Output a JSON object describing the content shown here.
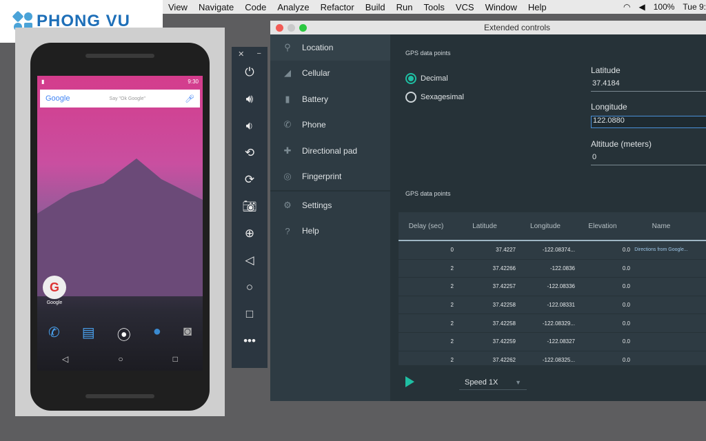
{
  "menubar": {
    "items": [
      "View",
      "Navigate",
      "Code",
      "Analyze",
      "Refactor",
      "Build",
      "Run",
      "Tools",
      "VCS",
      "Window",
      "Help"
    ],
    "battery": "100%",
    "clock": "Tue 9:"
  },
  "logo": {
    "text": "PHONG VU"
  },
  "phone": {
    "time": "9:30",
    "search_brand": "Google",
    "search_hint": "Say \"Ok Google\"",
    "app_label": "Google"
  },
  "window": {
    "title": "Extended controls"
  },
  "sidebar": {
    "items": [
      {
        "label": "Location",
        "icon": "location-pin"
      },
      {
        "label": "Cellular",
        "icon": "signal"
      },
      {
        "label": "Battery",
        "icon": "battery"
      },
      {
        "label": "Phone",
        "icon": "phone"
      },
      {
        "label": "Directional pad",
        "icon": "dpad"
      },
      {
        "label": "Fingerprint",
        "icon": "fingerprint"
      },
      {
        "label": "Settings",
        "icon": "gear"
      },
      {
        "label": "Help",
        "icon": "help"
      }
    ]
  },
  "main": {
    "section1": "GPS data points",
    "decimal": "Decimal",
    "sexagesimal": "Sexagesimal",
    "latitude_label": "Latitude",
    "latitude": "37.4184",
    "longitude_label": "Longitude",
    "longitude": "122.0880",
    "altitude_label": "Altitude (meters)",
    "altitude": "0",
    "section2": "GPS data points",
    "speed": "Speed 1X"
  },
  "table": {
    "headers": [
      "Delay (sec)",
      "Latitude",
      "Longitude",
      "Elevation",
      "Name"
    ],
    "rows": [
      [
        "0",
        "37.4227",
        "-122.08374...",
        "0.0",
        "Directions from Google..."
      ],
      [
        "2",
        "37.42266",
        "-122.0836",
        "0.0",
        ""
      ],
      [
        "2",
        "37.42257",
        "-122.08336",
        "0.0",
        ""
      ],
      [
        "2",
        "37.42258",
        "-122.08331",
        "0.0",
        ""
      ],
      [
        "2",
        "37.42258",
        "-122.08329...",
        "0.0",
        ""
      ],
      [
        "2",
        "37.42259",
        "-122.08327",
        "0.0",
        ""
      ],
      [
        "2",
        "37.42262",
        "-122.08325...",
        "0.0",
        ""
      ]
    ]
  },
  "colors": {
    "accent": "#1fbfa3",
    "panel": "#263238",
    "sidebar": "#2e3b43"
  }
}
